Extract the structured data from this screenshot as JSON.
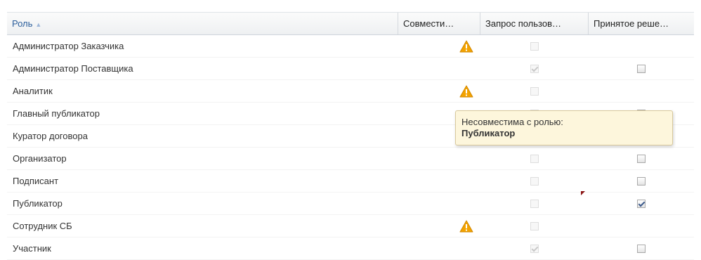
{
  "columns": {
    "role": "Роль",
    "compatibility": "Совмести…",
    "user_request": "Запрос пользов…",
    "decision": "Принятое реше…"
  },
  "rows": [
    {
      "role": "Администратор Заказчика",
      "warning": true,
      "request": {
        "checked": false
      },
      "decision": null
    },
    {
      "role": "Администратор Поставщика",
      "warning": false,
      "request": {
        "checked": true
      },
      "decision": {
        "checked": false
      }
    },
    {
      "role": "Аналитик",
      "warning": true,
      "request": {
        "checked": false
      },
      "decision": null
    },
    {
      "role": "Главный публикатор",
      "warning": false,
      "request": {
        "checked": false
      },
      "decision": {
        "checked": false
      }
    },
    {
      "role": "Куратор договора",
      "warning": false,
      "request": null,
      "decision": null
    },
    {
      "role": "Организатор",
      "warning": false,
      "request": {
        "checked": false
      },
      "decision": {
        "checked": false
      }
    },
    {
      "role": "Подписант",
      "warning": false,
      "request": {
        "checked": false
      },
      "decision": {
        "checked": false
      }
    },
    {
      "role": "Публикатор",
      "warning": false,
      "request": {
        "checked": false
      },
      "decision": {
        "checked": true
      }
    },
    {
      "role": "Сотрудник СБ",
      "warning": true,
      "request": {
        "checked": false
      },
      "decision": null
    },
    {
      "role": "Участник",
      "warning": false,
      "request": {
        "checked": true
      },
      "decision": {
        "checked": false
      }
    }
  ],
  "tooltip": {
    "line1": "Несовместима с ролью:",
    "role": "Публикатор"
  },
  "colors": {
    "warning": "#f3a300",
    "header_link": "#2a5d9b",
    "tooltip_bg": "#fdf6dc"
  },
  "icons": {
    "warning": "warning-icon",
    "sort": "sort-ascending-icon"
  }
}
